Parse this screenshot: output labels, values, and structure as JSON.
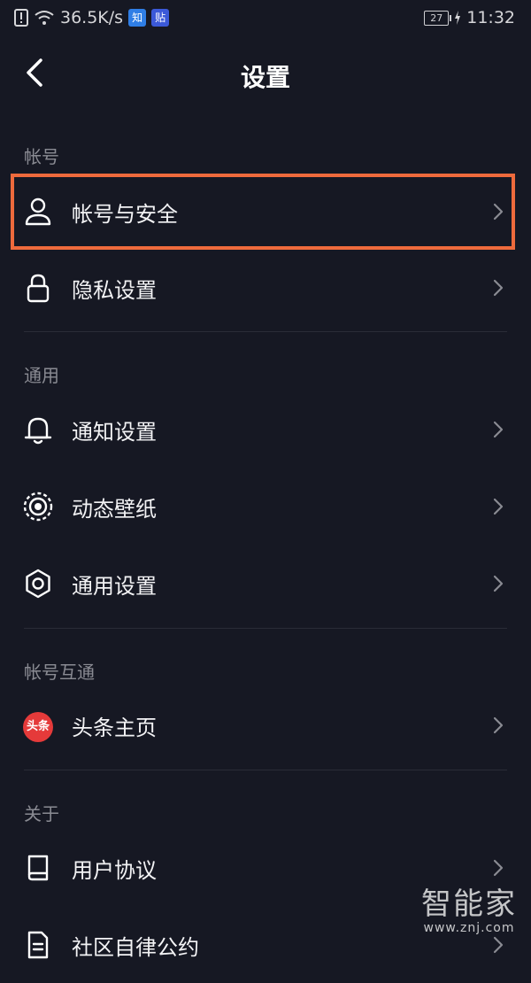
{
  "status_bar": {
    "speed": "36.5K/s",
    "app_badges": [
      {
        "text": "知",
        "color": "#2f7ee6"
      },
      {
        "text": "贴",
        "color": "#3b59d8"
      }
    ],
    "battery": "27",
    "time": "11:32"
  },
  "header": {
    "title": "设置"
  },
  "sections": {
    "account": {
      "heading": "帐号",
      "items": [
        {
          "label": "帐号与安全",
          "icon": "user-icon"
        },
        {
          "label": "隐私设置",
          "icon": "lock-icon"
        }
      ]
    },
    "general": {
      "heading": "通用",
      "items": [
        {
          "label": "通知设置",
          "icon": "bell-icon"
        },
        {
          "label": "动态壁纸",
          "icon": "live-wallpaper-icon"
        },
        {
          "label": "通用设置",
          "icon": "gear-icon"
        }
      ]
    },
    "linked": {
      "heading": "帐号互通",
      "items": [
        {
          "label": "头条主页",
          "icon": "toutiao-logo",
          "logo_text": "头条"
        }
      ]
    },
    "about": {
      "heading": "关于",
      "items": [
        {
          "label": "用户协议",
          "icon": "book-icon"
        },
        {
          "label": "社区自律公约",
          "icon": "document-icon"
        }
      ]
    }
  },
  "watermark": {
    "name": "智能家",
    "url": "www.znj.com"
  },
  "colors": {
    "background": "#161823",
    "highlight": "#ee6a3c",
    "section_text": "#8a8b93"
  }
}
